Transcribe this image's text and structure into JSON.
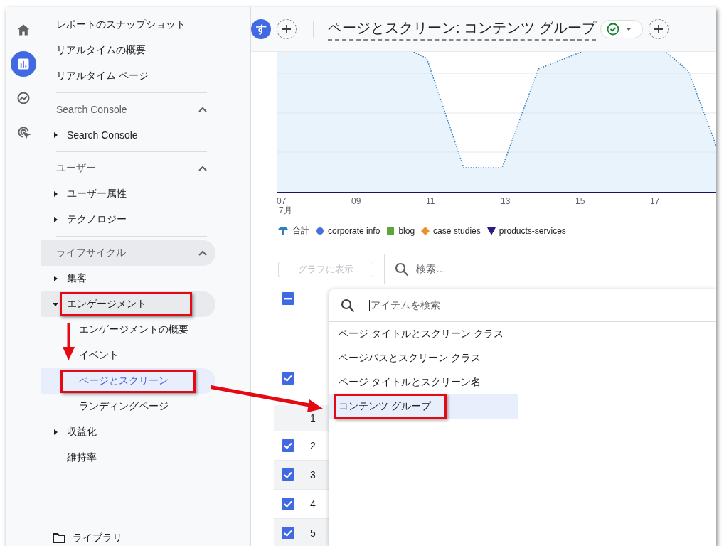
{
  "rail": {
    "items": [
      {
        "kind": "home",
        "selected": false
      },
      {
        "kind": "reports",
        "selected": true
      },
      {
        "kind": "explore",
        "selected": false
      },
      {
        "kind": "advertising",
        "selected": false
      }
    ]
  },
  "nav": {
    "top_items": [
      "レポートのスナップショット",
      "リアルタイムの概要",
      "リアルタイム ページ"
    ],
    "sections": [
      {
        "title": "Search Console",
        "expanded": true,
        "hovered": false,
        "items": [
          {
            "label": "Search Console",
            "kind": "group",
            "expanded": false
          }
        ]
      },
      {
        "title": "ユーザー",
        "expanded": true,
        "hovered": false,
        "items": [
          {
            "label": "ユーザー属性",
            "kind": "group",
            "expanded": false
          },
          {
            "label": "テクノロジー",
            "kind": "group",
            "expanded": false
          }
        ]
      },
      {
        "title": "ライフサイクル",
        "expanded": true,
        "hovered": true,
        "items": [
          {
            "label": "集客",
            "kind": "group",
            "expanded": false
          },
          {
            "label": "エンゲージメント",
            "kind": "group",
            "expanded": true,
            "children": [
              {
                "label": "エンゲージメントの概要",
                "selected": false
              },
              {
                "label": "イベント",
                "selected": false
              },
              {
                "label": "ページとスクリーン",
                "selected": true
              },
              {
                "label": "ランディングページ",
                "selected": false
              }
            ]
          },
          {
            "label": "収益化",
            "kind": "group",
            "expanded": false
          },
          {
            "label": "維持率",
            "kind": "link"
          }
        ]
      }
    ],
    "library": "ライブラリ"
  },
  "header": {
    "avatar": "す",
    "title": "ページとスクリーン: コンテンツ グループ",
    "status_ok": true
  },
  "chart": {
    "x_labels": [
      "07",
      "09",
      "11",
      "13",
      "15",
      "17"
    ],
    "month": "7月",
    "legend": [
      {
        "label": "合計",
        "kind": "drop",
        "color": "#2f7fc1"
      },
      {
        "label": "corporate info",
        "kind": "circle",
        "color": "#4a6ee0"
      },
      {
        "label": "blog",
        "kind": "square",
        "color": "#5ba63c"
      },
      {
        "label": "case studies",
        "kind": "diamond",
        "color": "#e8902a"
      },
      {
        "label": "products-services",
        "kind": "triangle",
        "color": "#2b1d7f"
      }
    ]
  },
  "toolbar": {
    "chart_button": "グラフに表示",
    "chart_button_disabled": true,
    "search_placeholder": "検索…"
  },
  "table": {
    "select_all": {
      "indeterminate": true
    },
    "total_row": {
      "checked": true
    },
    "rows": [
      {
        "number": "1",
        "checkbox": false
      },
      {
        "number": "2",
        "checkbox": true,
        "checked": true
      },
      {
        "number": "3",
        "checkbox": true,
        "checked": true
      },
      {
        "number": "4",
        "checkbox": true,
        "checked": true
      },
      {
        "number": "5",
        "checkbox": true,
        "checked": true
      }
    ]
  },
  "dropdown": {
    "placeholder": "アイテムを検索",
    "options": [
      {
        "label": "ページ タイトルとスクリーン クラス",
        "selected": false
      },
      {
        "label": "ページパスとスクリーン クラス",
        "selected": false
      },
      {
        "label": "ページ タイトルとスクリーン名",
        "selected": false
      },
      {
        "label": "コンテンツ グループ",
        "selected": true
      }
    ]
  }
}
